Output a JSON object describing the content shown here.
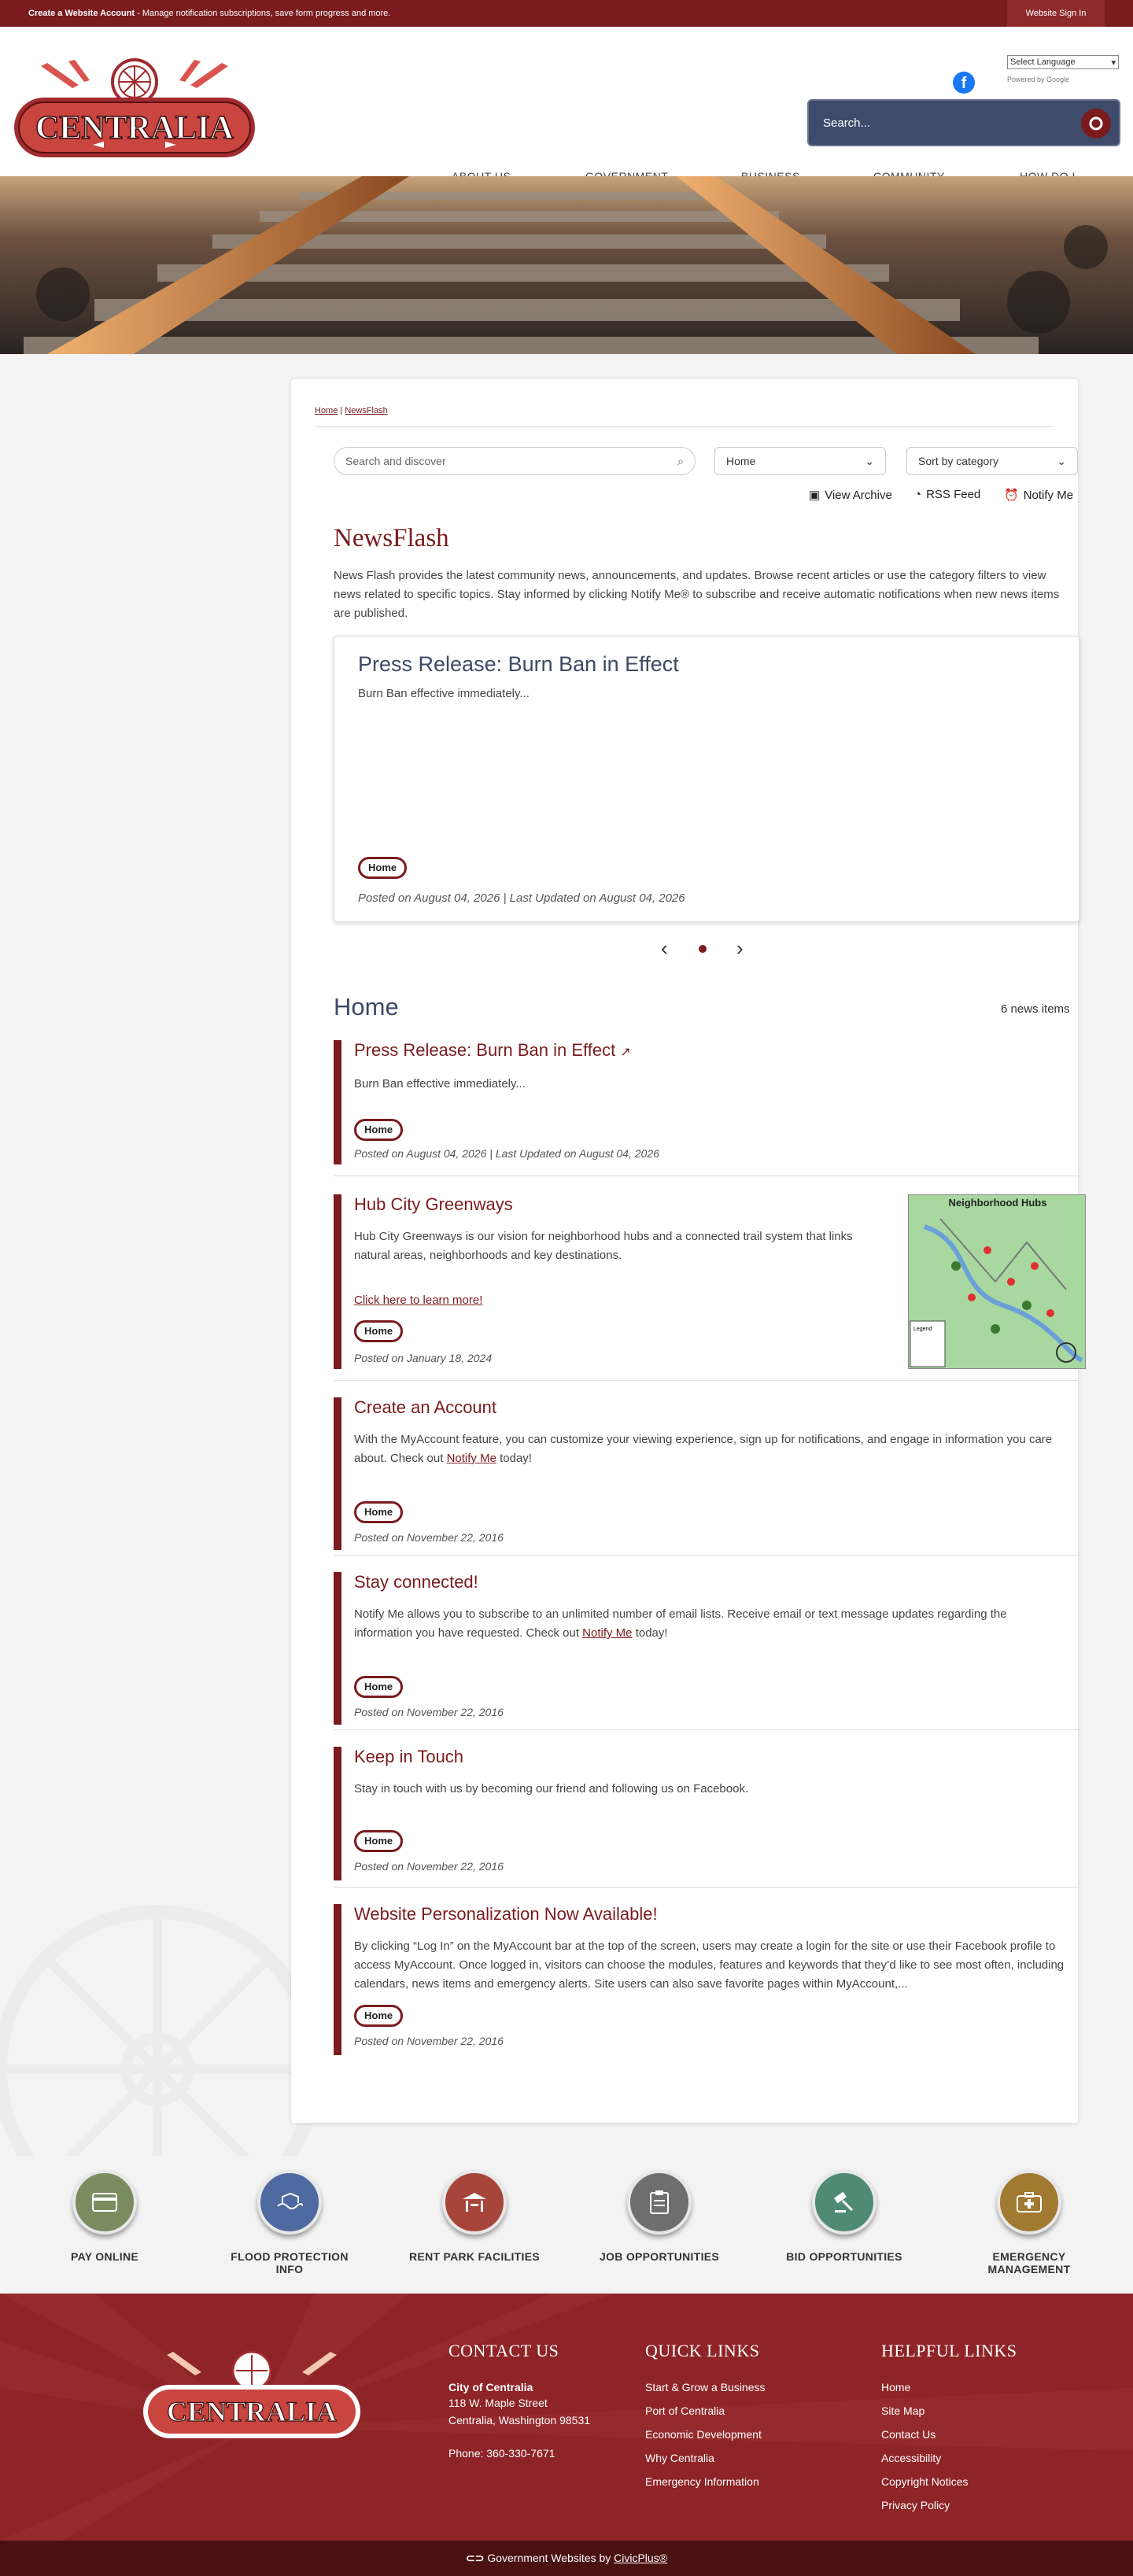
{
  "topbar": {
    "account_bold": "Create a Website Account",
    "account_text": " - Manage notification subscriptions, save form progress and more.",
    "signin": "Website Sign In"
  },
  "header": {
    "logo_text": "CENTRALIA",
    "language": "Select Language",
    "powered_by": "Powered by Google",
    "search_placeholder": "Search...",
    "nav": [
      "ABOUT US",
      "GOVERNMENT",
      "BUSINESS",
      "COMMUNITY",
      "HOW DO I..."
    ]
  },
  "breadcrumb": {
    "home": "Home",
    "sep": " | ",
    "current": "NewsFlash"
  },
  "filters": {
    "search_placeholder": "Search and discover",
    "category": "Home",
    "sort": "Sort by category",
    "view_archive": "View Archive",
    "rss": "RSS Feed",
    "notify": "Notify Me"
  },
  "newsflash": {
    "title": "NewsFlash",
    "description": "News Flash provides the latest community news, announcements, and updates. Browse recent articles or use the category filters to view news related to specific topics. Stay informed by clicking Notify Me® to subscribe and receive automatic notifications when new news items are published."
  },
  "featured": {
    "title": "Press Release: Burn Ban in Effect",
    "summary": "Burn Ban effective immediately...",
    "tag": "Home",
    "posted": "Posted on August 04, 2026 | Last Updated on August 04, 2026"
  },
  "list": {
    "heading": "Home",
    "count": "6 news items",
    "items": [
      {
        "title": "Press Release: Burn Ban in Effect",
        "body": "Burn Ban effective immediately...",
        "tag": "Home",
        "posted": "Posted on August 04, 2026 | Last Updated on August 04, 2026"
      },
      {
        "title": "Hub City Greenways",
        "body": "Hub City Greenways is our vision for neighborhood hubs and a connected trail system that links natural areas, neighborhoods and key destinations.",
        "link": "Click here to learn more!",
        "tag": "Home",
        "posted": "Posted on January 18, 2024",
        "map_title": "Neighborhood Hubs",
        "map_legend": "Legend"
      },
      {
        "title": "Create an Account",
        "body_pre": "With the MyAccount feature, you can customize your viewing experience, sign up for notifications, and engage in information you care about. Check out ",
        "body_link": "Notify Me",
        "body_post": " today!",
        "tag": "Home",
        "posted": "Posted on November 22, 2016"
      },
      {
        "title": "Stay connected!",
        "body_pre": "Notify Me allows you to subscribe to an unlimited number of email lists. Receive email or text message updates regarding the information you have requested. Check out ",
        "body_link": "Notify Me",
        "body_post": " today!",
        "tag": "Home",
        "posted": "Posted on November 22, 2016"
      },
      {
        "title": "Keep in Touch",
        "body": "Stay in touch with us by becoming our friend and following us on Facebook.",
        "tag": "Home",
        "posted": "Posted on November 22, 2016"
      },
      {
        "title": "Website Personalization Now Available!",
        "body": "By clicking “Log In” on the MyAccount bar at the top of the screen, users may create a login for the site or use their Facebook profile to access MyAccount. Once logged in, visitors can choose the modules, features and keywords that they’d like to see most often, including calendars, news items and emergency alerts. Site users can also save favorite pages within MyAccount,...",
        "tag": "Home",
        "posted": "Posted on November 22, 2016"
      }
    ]
  },
  "quick_links": [
    {
      "label": "PAY ONLINE",
      "icon": "credit-card-icon",
      "color": "#7a8c60"
    },
    {
      "label": "FLOOD PROTECTION INFO",
      "icon": "flood-wave-icon",
      "color": "#4e6aa0"
    },
    {
      "label": "RENT PARK FACILITIES",
      "icon": "pavilion-icon",
      "color": "#a8453a"
    },
    {
      "label": "JOB OPPORTUNITIES",
      "icon": "clipboard-icon",
      "color": "#6e6e6e"
    },
    {
      "label": "BID OPPORTUNITIES",
      "icon": "gavel-icon",
      "color": "#4f8a74"
    },
    {
      "label": "EMERGENCY MANAGEMENT",
      "icon": "first-aid-kit-icon",
      "color": "#a07a30"
    }
  ],
  "footer": {
    "contact": {
      "heading": "CONTACT US",
      "name": "City of Centralia",
      "address1": "118 W. Maple Street",
      "address2": "Centralia, Washington 98531",
      "phone": "Phone: 360-330-7671"
    },
    "quick_links": {
      "heading": "QUICK LINKS",
      "links": [
        "Start & Grow a Business",
        "Port of Centralia",
        "Economic Development",
        "Why Centralia",
        "Emergency Information"
      ]
    },
    "helpful_links": {
      "heading": "HELPFUL LINKS",
      "links": [
        "Home",
        "Site Map",
        "Contact Us",
        "Accessibility",
        "Copyright Notices",
        "Privacy Policy"
      ]
    },
    "bottom_prefix": "Government Websites by ",
    "bottom_link": "CivicPlus®"
  },
  "colors": {
    "brand": "#7a1b1e",
    "nav_text": "#444444",
    "footer": "#8e2427"
  }
}
